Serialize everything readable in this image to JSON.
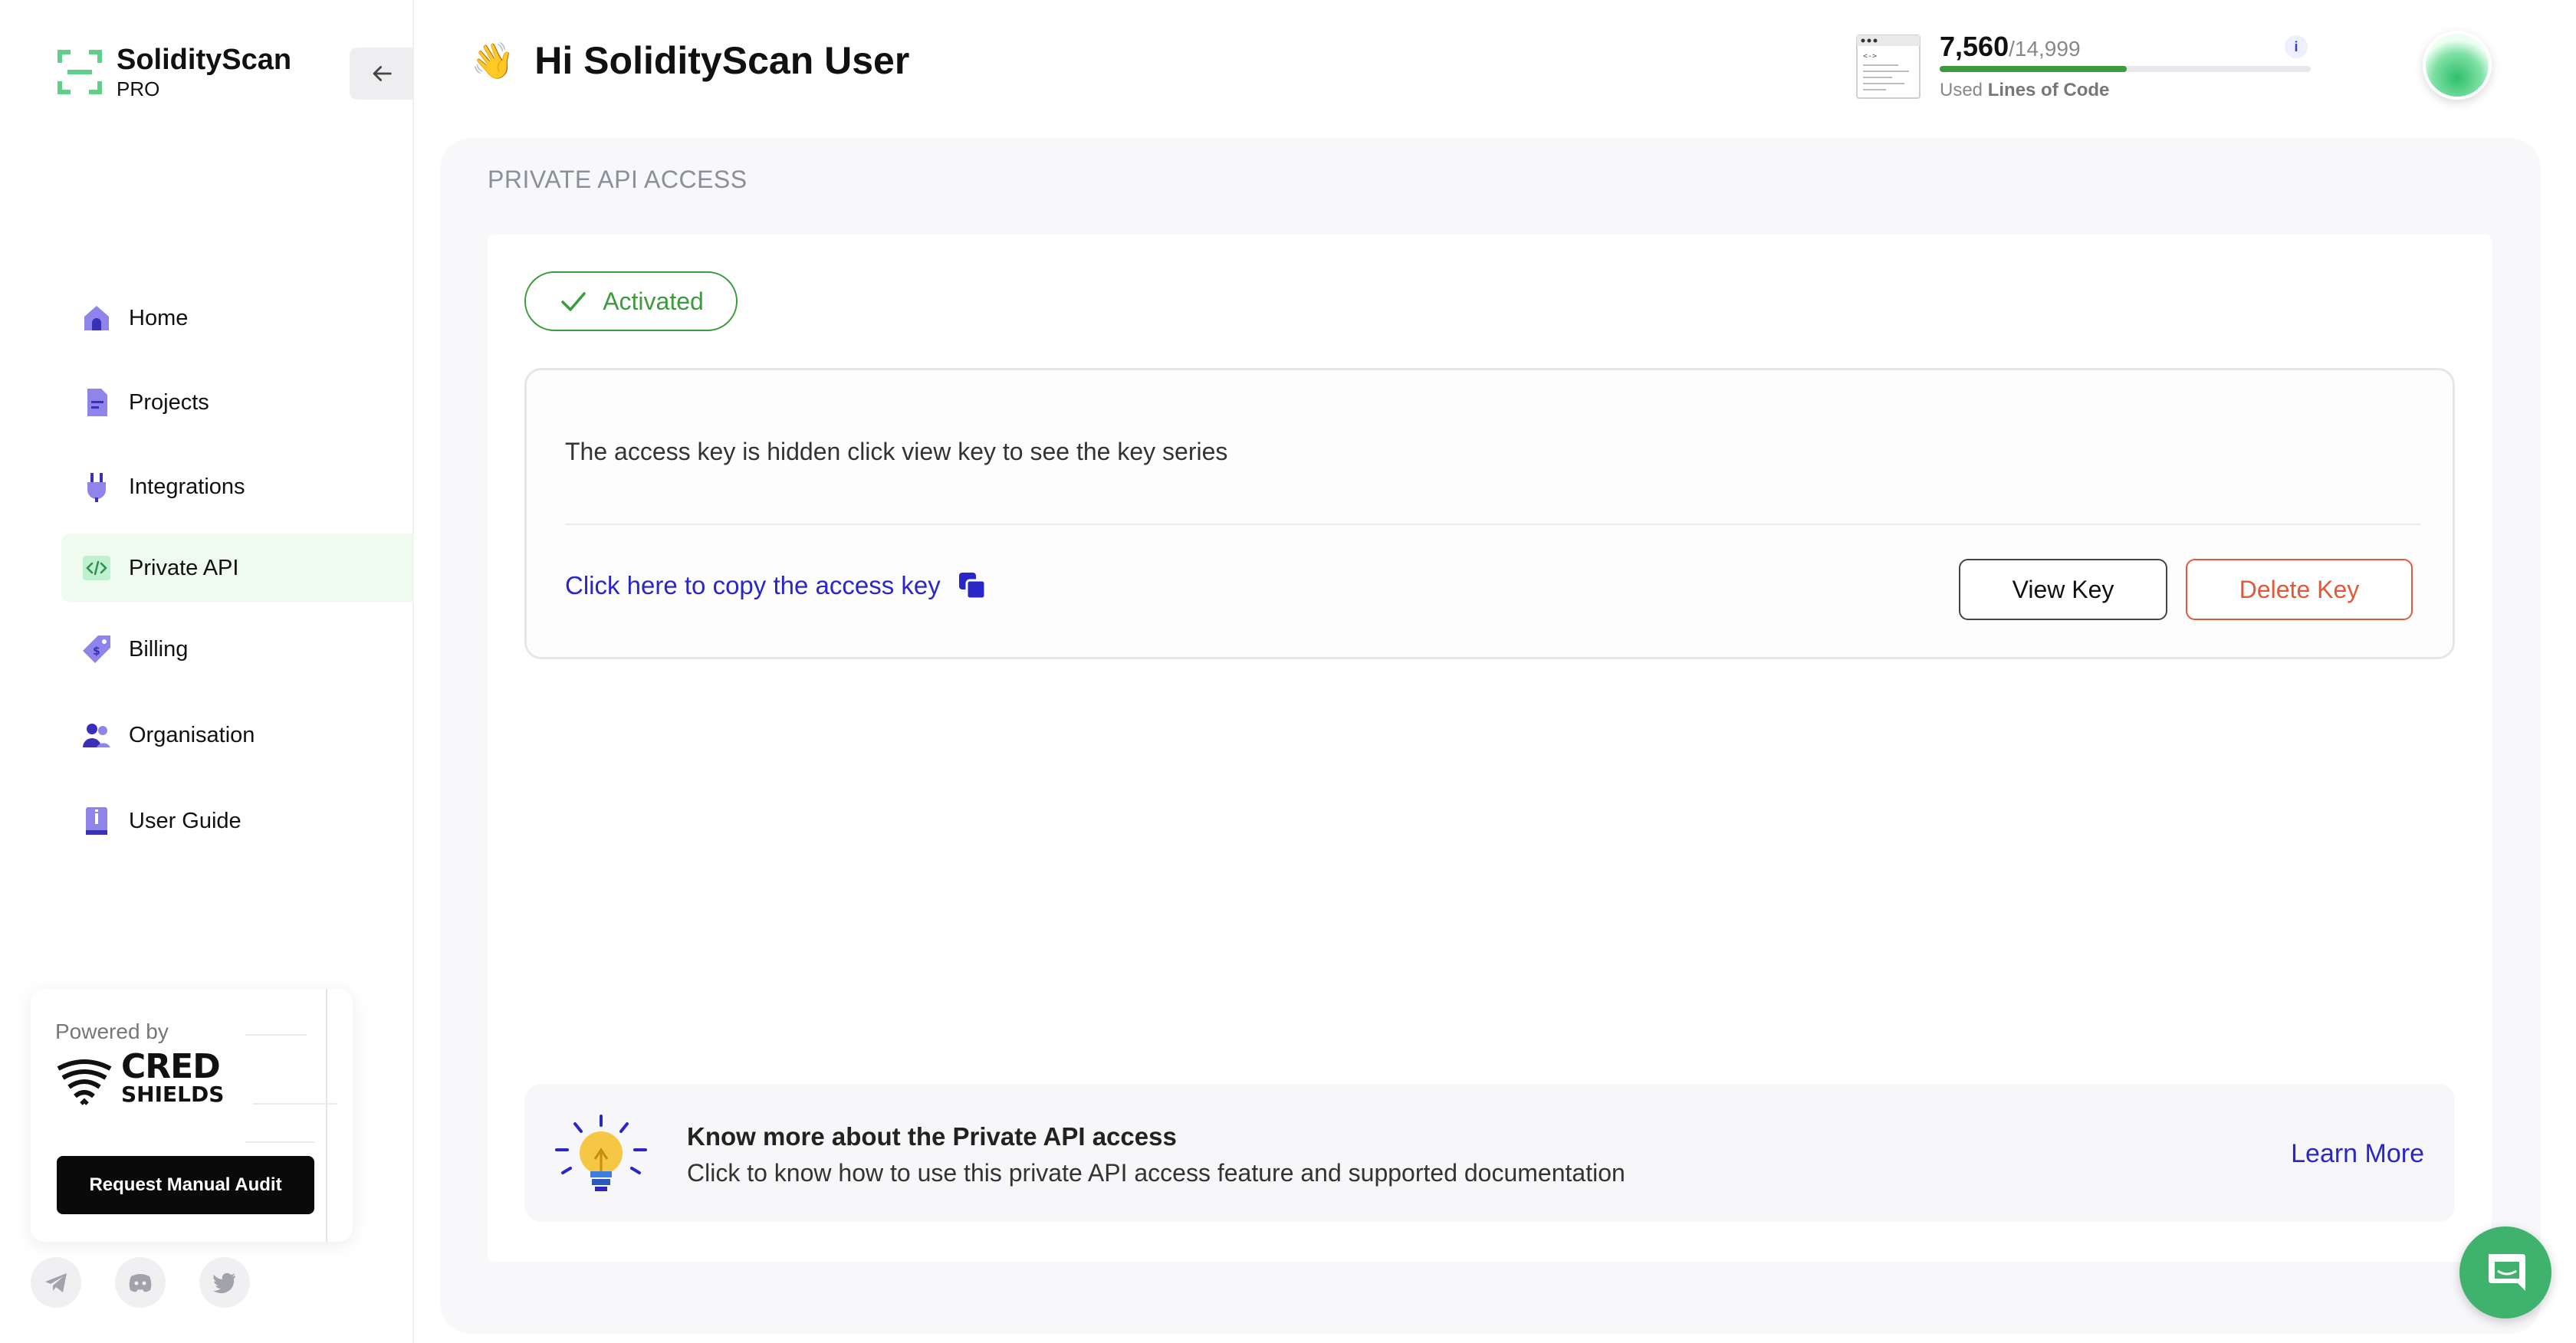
{
  "app": {
    "brand": "SolidityScan",
    "tier": "PRO"
  },
  "sidebar": {
    "items": [
      {
        "label": "Home",
        "icon": "home-icon"
      },
      {
        "label": "Projects",
        "icon": "document-icon"
      },
      {
        "label": "Integrations",
        "icon": "plug-icon"
      },
      {
        "label": "Private API",
        "icon": "code-icon",
        "active": true
      },
      {
        "label": "Billing",
        "icon": "price-tag-icon"
      },
      {
        "label": "Organisation",
        "icon": "users-icon"
      },
      {
        "label": "User Guide",
        "icon": "book-icon"
      }
    ],
    "powered": {
      "prefix": "Powered by",
      "logo_line1": "CRED",
      "logo_line2": "SHIELDS",
      "audit_button": "Request Manual Audit"
    },
    "socials": [
      "telegram-icon",
      "discord-icon",
      "twitter-icon"
    ]
  },
  "header": {
    "wave": "👋",
    "greeting": "Hi SolidityScan User",
    "usage": {
      "used": "7,560",
      "total": "/14,999",
      "used_fraction": 0.504,
      "caption_prefix": "Used ",
      "caption_bold": "Lines of Code",
      "info": "i"
    }
  },
  "main": {
    "section_title": "PRIVATE API ACCESS",
    "status": "Activated",
    "key_message": "The access key is hidden click view key to see the key series",
    "copy_link": "Click here to copy the access key",
    "view_button": "View Key",
    "delete_button": "Delete Key",
    "info": {
      "title": "Know more about the Private API access",
      "description": "Click to know how to use this private API access feature and supported documentation",
      "link": "Learn More"
    }
  },
  "colors": {
    "accent": "#2a26c8",
    "success": "#3c9b3c",
    "danger": "#e4583a",
    "nav_icon": "#6b5bd6",
    "active_bg": "#eefbee"
  }
}
